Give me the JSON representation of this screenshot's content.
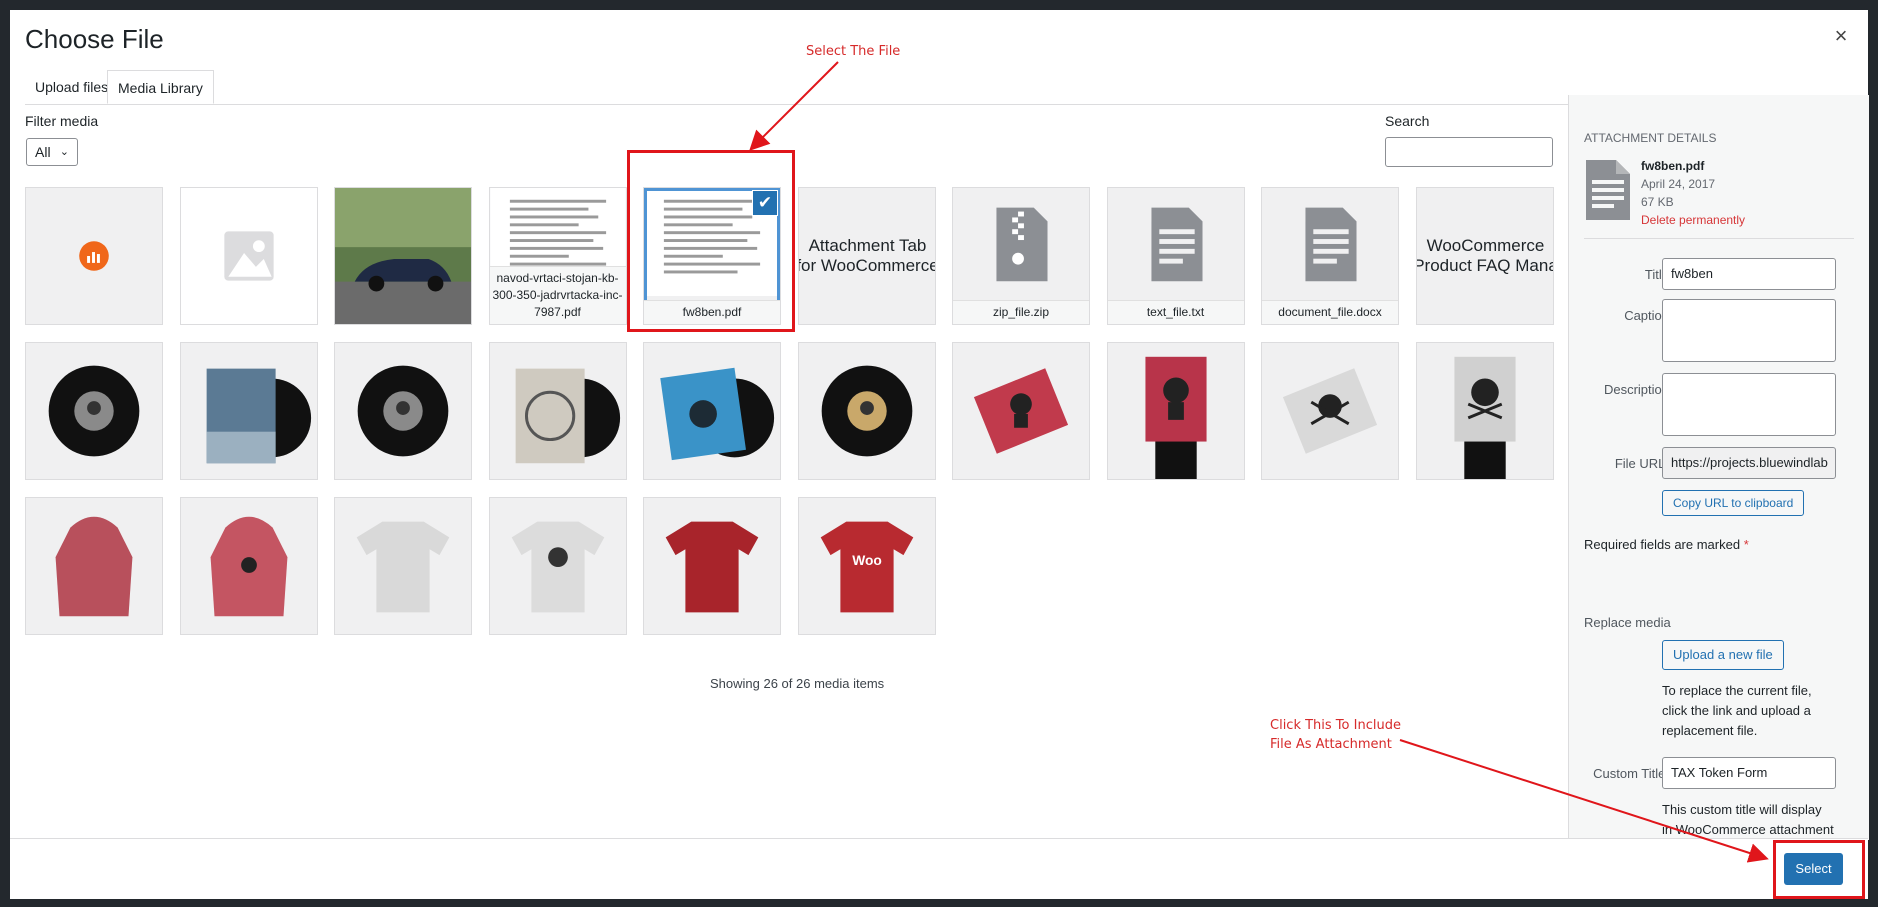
{
  "modal": {
    "title": "Choose File",
    "close_glyph": "×",
    "tabs": [
      "Upload files",
      "Media Library"
    ],
    "active_tab": "Media Library"
  },
  "filter": {
    "label": "Filter media",
    "value": "All"
  },
  "search": {
    "label": "Search",
    "placeholder": ""
  },
  "media_items": [
    {
      "type": "chart-icon",
      "name": ""
    },
    {
      "type": "placeholder-image",
      "name": ""
    },
    {
      "type": "car-photo",
      "name": ""
    },
    {
      "type": "pdf-preview",
      "name": "navod-vrtaci-stojan-kb-300-350-jadrvrtacka-inc-7987.pdf"
    },
    {
      "type": "pdf-preview",
      "name": "fw8ben.pdf",
      "selected": true
    },
    {
      "type": "text-image",
      "name": "",
      "image_text": [
        "Attachment Tab",
        "for WooCommerce"
      ]
    },
    {
      "type": "zip-icon",
      "name": "zip_file.zip"
    },
    {
      "type": "document-icon",
      "name": "text_file.txt"
    },
    {
      "type": "document-icon",
      "name": "document_file.docx"
    },
    {
      "type": "text-image",
      "name": "",
      "image_text": [
        "WooCommerce",
        "Product FAQ Mana"
      ]
    },
    {
      "type": "vinyl-dark",
      "name": ""
    },
    {
      "type": "album-woo",
      "name": ""
    },
    {
      "type": "vinyl-dark",
      "name": ""
    },
    {
      "type": "album-white",
      "name": ""
    },
    {
      "type": "album-blue",
      "name": ""
    },
    {
      "type": "vinyl-gold",
      "name": ""
    },
    {
      "type": "poster-red",
      "name": ""
    },
    {
      "type": "poster-held-red",
      "name": ""
    },
    {
      "type": "poster-grey",
      "name": ""
    },
    {
      "type": "poster-held-grey",
      "name": ""
    },
    {
      "type": "hoodie-red",
      "name": ""
    },
    {
      "type": "hoodie-red-print",
      "name": ""
    },
    {
      "type": "tshirt-grey",
      "name": ""
    },
    {
      "type": "tshirt-grey-print",
      "name": ""
    },
    {
      "type": "tshirt-red",
      "name": ""
    },
    {
      "type": "tshirt-red-woo",
      "name": ""
    }
  ],
  "showing_text": "Showing 26 of 26 media items",
  "details": {
    "heading": "Attachment Details",
    "filename": "fw8ben.pdf",
    "date": "April 24, 2017",
    "size": "67 KB",
    "delete_label": "Delete permanently",
    "title_label": "Title",
    "title_value": "fw8ben",
    "caption_label": "Caption",
    "description_label": "Description",
    "file_url_label": "File URL:",
    "file_url_value": "https://projects.bluewindlab",
    "copy_url_label": "Copy URL to clipboard",
    "required_note": "Required fields are marked",
    "required_star": "*",
    "replace_label": "Replace media",
    "upload_new_label": "Upload a new file",
    "replace_help": [
      "To replace the current file,",
      "click the link and upload a",
      "replacement file."
    ],
    "custom_title_label": "Custom Title:",
    "custom_title_value": "TAX Token Form",
    "custom_help": [
      "This custom title will display",
      "in WooCommerce attachment"
    ]
  },
  "footer": {
    "select_label": "Select"
  },
  "annotations": {
    "select_file": "Select The File",
    "click_include": [
      "Click This To Include",
      "File As Attachment"
    ],
    "color": "#e0161b"
  },
  "colors": {
    "primary": "#2271b1",
    "danger": "#d63638",
    "woo_orange": "#f0671a"
  }
}
